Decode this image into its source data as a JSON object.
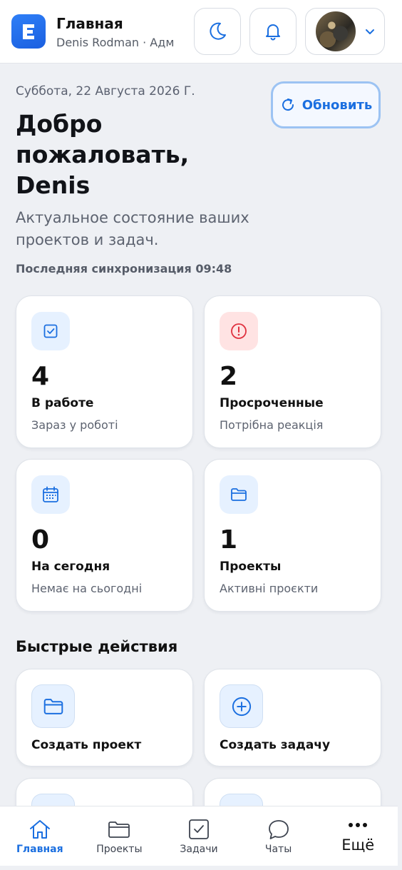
{
  "header": {
    "logo_letter": "E",
    "title": "Главная",
    "subtitle": "Denis Rodman · Адм",
    "icons": [
      "moon-icon",
      "bell-icon",
      "avatar",
      "chevron-down-icon"
    ]
  },
  "intro": {
    "date": "Суббота, 22 Августа 2026 Г.",
    "welcome": "Добро пожаловать, Denis",
    "description": "Актуальное состояние ваших проектов и задач.",
    "sync": "Последняя синхронизация 09:48",
    "refresh_label": "Обновить"
  },
  "stats": [
    {
      "value": "4",
      "label": "В работе",
      "sub": "Зараз у роботі",
      "icon": "checkbox-icon"
    },
    {
      "value": "2",
      "label": "Просроченные",
      "sub": "Потрібна реакція",
      "icon": "alert-circle-icon"
    },
    {
      "value": "0",
      "label": "На сегодня",
      "sub": "Немає на сьогодні",
      "icon": "calendar-icon"
    },
    {
      "value": "1",
      "label": "Проекты",
      "sub": "Активні проєкти",
      "icon": "folder-icon"
    }
  ],
  "quick_actions": {
    "title": "Быстрые действия",
    "items": [
      {
        "label": "Создать проект",
        "icon": "folder-icon"
      },
      {
        "label": "Создать задачу",
        "icon": "plus-circle-icon"
      }
    ]
  },
  "bottom_nav": [
    {
      "label": "Главная",
      "icon": "home-icon",
      "active": true
    },
    {
      "label": "Проекты",
      "icon": "folder-icon",
      "active": false
    },
    {
      "label": "Задачи",
      "icon": "checkbox-icon",
      "active": false
    },
    {
      "label": "Чаты",
      "icon": "chat-icon",
      "active": false
    },
    {
      "label": "Ещё",
      "icon": "more-icon",
      "active": false
    }
  ],
  "colors": {
    "accent": "#1b6fe0",
    "danger": "#e0313f",
    "background": "#eef0f4"
  }
}
